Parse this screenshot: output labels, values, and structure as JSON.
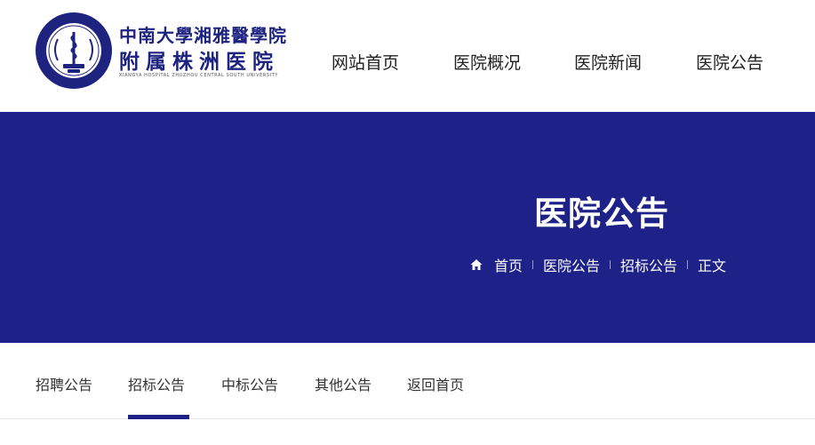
{
  "logo": {
    "cn_small": "中南大學湘雅醫學院",
    "cn_big": "附属株洲医院",
    "en": "XIANGYA HOSPITAL ZHUZHOU CENTRAL SOUTH UNIVERSITY",
    "brand_color": "#1e2380"
  },
  "nav": {
    "items": [
      "网站首页",
      "医院概况",
      "医院新闻",
      "医院公告"
    ]
  },
  "banner": {
    "title": "医院公告",
    "background": "#1e2288",
    "breadcrumb": {
      "icon": "home-icon",
      "items": [
        "首页",
        "医院公告",
        "招标公告",
        "正文"
      ]
    }
  },
  "subnav": {
    "items": [
      "招聘公告",
      "招标公告",
      "中标公告",
      "其他公告",
      "返回首页"
    ],
    "active": "招标公告"
  }
}
